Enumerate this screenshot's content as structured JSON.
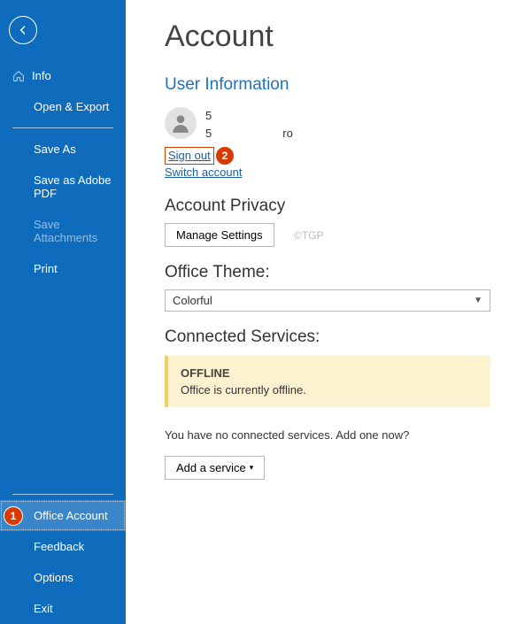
{
  "sidebar": {
    "info": "Info",
    "openExport": "Open & Export",
    "saveAs": "Save As",
    "savePdf": "Save as Adobe PDF",
    "saveAttachments": "Save Attachments",
    "print": "Print",
    "officeAccount": "Office Account",
    "feedback": "Feedback",
    "options": "Options",
    "exit": "Exit"
  },
  "badges": {
    "one": "1",
    "two": "2"
  },
  "main": {
    "title": "Account",
    "userInfo": "User Information",
    "userLine1Prefix": "5",
    "userLine2Prefix": "5",
    "userLine2Suffix": "ro",
    "signOut": "Sign out",
    "switchAccount": "Switch account",
    "privacy": "Account Privacy",
    "manageSettings": "Manage Settings",
    "watermark": "©TGP",
    "theme": "Office Theme:",
    "themeValue": "Colorful",
    "connected": "Connected Services:",
    "offlineTitle": "OFFLINE",
    "offlineMsg": "Office is currently offline.",
    "noServices": "You have no connected services. Add one now?",
    "addService": "Add a service"
  }
}
